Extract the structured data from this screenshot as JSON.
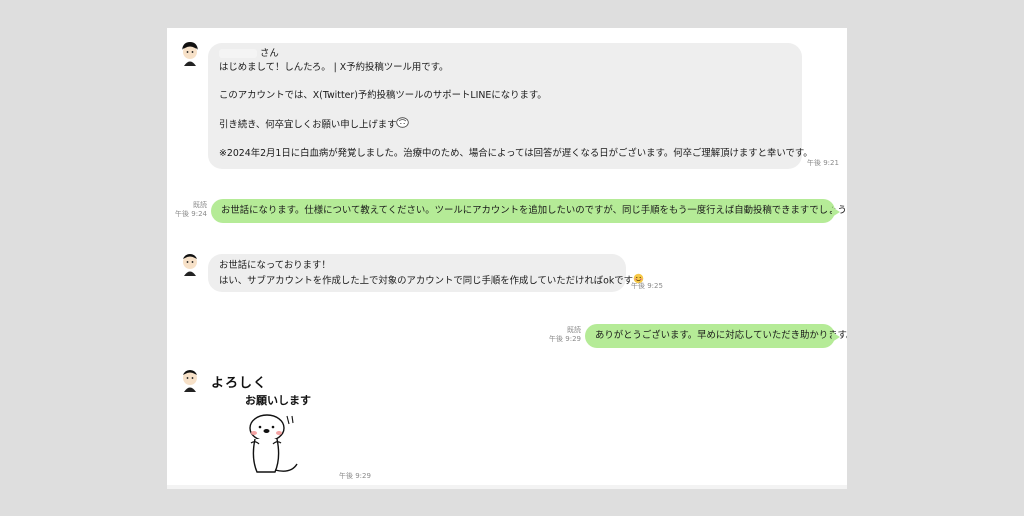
{
  "chat": {
    "messages": [
      {
        "from": "support",
        "lines": [
          "さん",
          "はじめまして！しんたろ。 | X予約投稿ツール用です。",
          "",
          "このアカウントでは、X(Twitter)予約投稿ツールのサポートLINEになります。",
          "",
          "引き続き、何卒宜しくお願い申し上げます",
          "",
          "※2024年2月1日に白血病が発覚しました。治療中のため、場合によっては回答が遅くなる日がございます。何卒ご理解頂けますと幸いです。"
        ],
        "time": "午後 9:21"
      },
      {
        "from": "me",
        "read": "既読",
        "text": "お世話になります。仕様について教えてください。ツールにアカウントを追加したいのですが、同じ手順をもう一度行えば自動投稿できますでしょうか？",
        "time": "午後 9:24"
      },
      {
        "from": "support",
        "lines": [
          "お世話になっております！",
          "はい、サブアカウントを作成した上で対象のアカウントで同じ手順を作成していただければokです"
        ],
        "time": "午後 9:25"
      },
      {
        "from": "me",
        "read": "既読",
        "text": "ありがとうございます。早めに対応していただき助かります。",
        "time": "午後 9:29"
      },
      {
        "from": "support",
        "sticker_text": [
          "よろしく",
          "お願いします"
        ],
        "time": "午後 9:29"
      }
    ]
  }
}
